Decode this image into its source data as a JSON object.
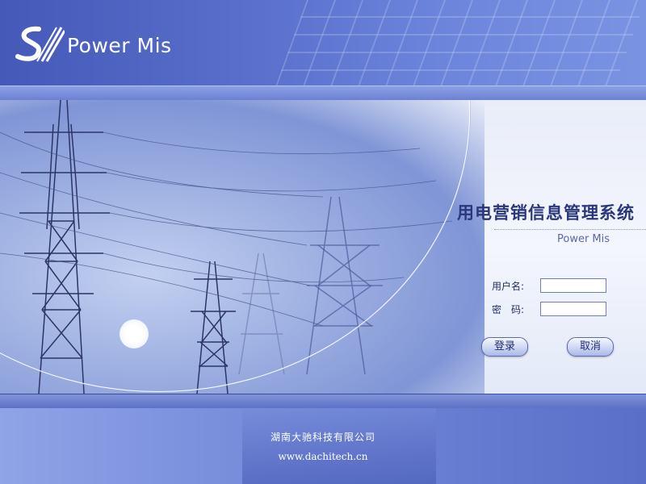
{
  "header": {
    "brand": "Power Mis"
  },
  "main": {
    "system_title": "用电营销信息管理系统",
    "system_subtitle": "Power Mis"
  },
  "login": {
    "username_label": "用户名:",
    "password_label": "密　码:",
    "username_value": "",
    "password_value": "",
    "login_button": "登录",
    "cancel_button": "取消"
  },
  "footer": {
    "company": "湖南大驰科技有限公司",
    "website": "www.dachitech.cn"
  },
  "colors": {
    "header_bg": "#4f63c0",
    "title_text": "#2a377a",
    "button_text": "#23306f"
  }
}
